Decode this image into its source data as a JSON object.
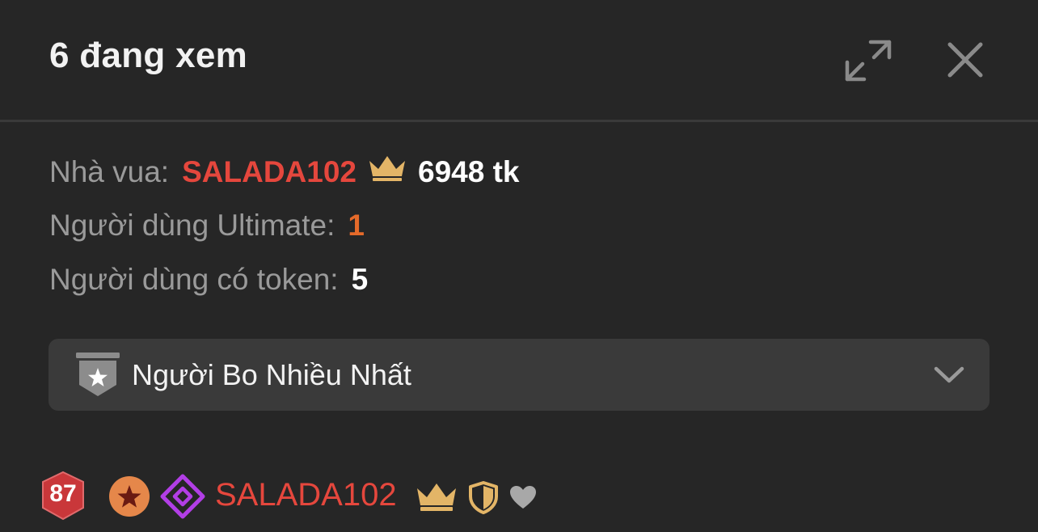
{
  "header": {
    "title": "6 đang xem",
    "expand_icon": "expand-arrows-icon",
    "close_icon": "close-icon"
  },
  "stats": {
    "king_label": "Nhà vua:",
    "king_name": "SALADA102",
    "king_tokens": "6948 tk",
    "ultimate_label": "Người dùng Ultimate:",
    "ultimate_count": "1",
    "token_users_label": "Người dùng có token:",
    "token_users_count": "5"
  },
  "dropdown": {
    "icon": "star-banner-icon",
    "label": "Người Bo Nhiều Nhất"
  },
  "users": [
    {
      "level": "87",
      "name": "SALADA102",
      "badges": [
        "star-badge-icon",
        "diamond-badge-icon",
        "crown-icon",
        "shield-icon",
        "heart-icon"
      ]
    }
  ],
  "colors": {
    "background": "#262626",
    "king_name": "#e5473d",
    "ultimate_count": "#e56a2a",
    "crown": "#e3b567",
    "dropdown_bg": "#3a3a3a",
    "diamond": "#b23ee6",
    "level_badge": "#c9373a"
  }
}
